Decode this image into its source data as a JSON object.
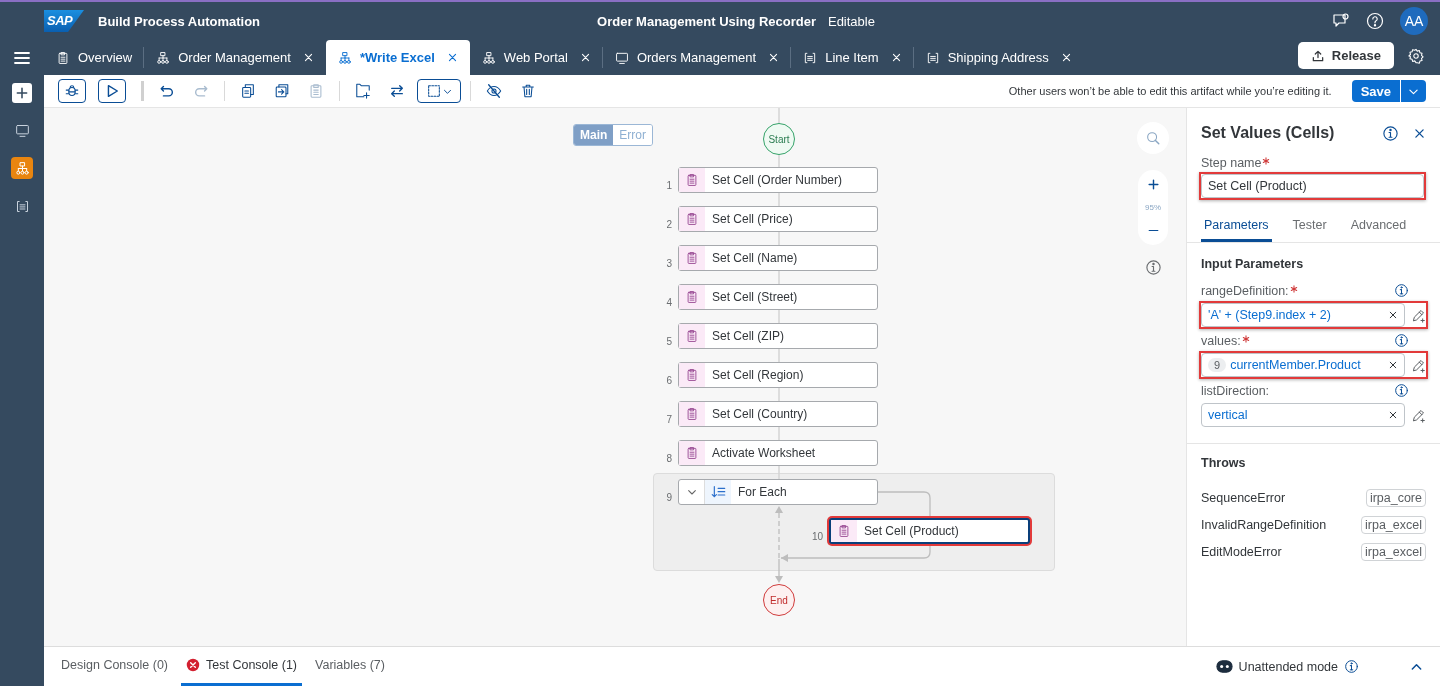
{
  "header": {
    "logo": "SAP",
    "product": "Build Process Automation",
    "title": "Order Management Using Recorder",
    "status": "Editable",
    "avatar": "AA"
  },
  "tabs": [
    {
      "label": "Overview",
      "kind": "overview",
      "closable": false,
      "selected": false
    },
    {
      "label": "Order Management",
      "kind": "process",
      "closable": true,
      "selected": false
    },
    {
      "label": "*Write Excel",
      "kind": "process",
      "closable": true,
      "selected": true
    },
    {
      "label": "Web Portal",
      "kind": "process",
      "closable": true,
      "selected": false
    },
    {
      "label": "Orders Management",
      "kind": "application",
      "closable": true,
      "selected": false
    },
    {
      "label": "Line Item",
      "kind": "data",
      "closable": true,
      "selected": false
    },
    {
      "label": "Shipping Address",
      "kind": "data",
      "closable": true,
      "selected": false
    }
  ],
  "release_button": "Release",
  "sidebar": {
    "items": [
      {
        "kind": "application",
        "selected": false
      },
      {
        "kind": "process",
        "selected": true
      },
      {
        "kind": "data",
        "selected": false
      }
    ]
  },
  "toolbar": {
    "buttons": [
      {
        "kind": "debug",
        "disabled": false
      },
      {
        "kind": "run",
        "disabled": false
      },
      {
        "kind": "undo",
        "disabled": false
      },
      {
        "kind": "redo",
        "disabled": true
      },
      {
        "kind": "copy",
        "disabled": false
      },
      {
        "kind": "duplicate",
        "disabled": false
      },
      {
        "kind": "paste",
        "disabled": true
      },
      {
        "kind": "add-group",
        "disabled": false
      },
      {
        "kind": "swap",
        "disabled": false
      },
      {
        "kind": "select",
        "disabled": false
      },
      {
        "kind": "hide",
        "disabled": false
      },
      {
        "kind": "delete",
        "disabled": false
      }
    ],
    "notice": "Other users won’t be able to edit this artifact while you’re editing it.",
    "save": "Save"
  },
  "canvas": {
    "mode_toggle": [
      {
        "label": "Main",
        "selected": true
      },
      {
        "label": "Error",
        "selected": false
      }
    ],
    "start": "Start",
    "end": "End",
    "zoom": "95%",
    "steps": [
      {
        "number": "1",
        "label": "Set Cell (Order Number)",
        "kind": "activity",
        "highlighted": false
      },
      {
        "number": "2",
        "label": "Set Cell (Price)",
        "kind": "activity",
        "highlighted": false
      },
      {
        "number": "3",
        "label": "Set Cell (Name)",
        "kind": "activity",
        "highlighted": false
      },
      {
        "number": "4",
        "label": "Set Cell (Street)",
        "kind": "activity",
        "highlighted": false
      },
      {
        "number": "5",
        "label": "Set Cell (ZIP)",
        "kind": "activity",
        "highlighted": false
      },
      {
        "number": "6",
        "label": "Set Cell (Region)",
        "kind": "activity",
        "highlighted": false
      },
      {
        "number": "7",
        "label": "Set Cell (Country)",
        "kind": "activity",
        "highlighted": false
      },
      {
        "number": "8",
        "label": "Activate Worksheet",
        "kind": "activity",
        "highlighted": false
      },
      {
        "number": "9",
        "label": "For Each",
        "kind": "loop",
        "highlighted": false,
        "expanded": true,
        "children": [
          {
            "number": "10",
            "label": "Set Cell (Product)",
            "kind": "activity",
            "highlighted": true
          }
        ]
      }
    ]
  },
  "panel": {
    "title": "Set Values (Cells)",
    "step_name": {
      "label": "Step name",
      "required": true,
      "value": "Set Cell (Product)",
      "highlighted": true
    },
    "tabs": [
      {
        "label": "Parameters",
        "selected": true
      },
      {
        "label": "Tester",
        "selected": false
      },
      {
        "label": "Advanced",
        "selected": false
      }
    ],
    "section": "Input Parameters",
    "params": [
      {
        "label": "rangeDefinition:",
        "required": true,
        "value": "'A' + (Step9.index + 2)",
        "highlighted": true
      },
      {
        "label": "values:",
        "required": true,
        "badge": "9",
        "value": "currentMember.Product",
        "highlighted": true
      },
      {
        "label": "listDirection:",
        "required": false,
        "value": "vertical",
        "highlighted": false
      }
    ],
    "throws_title": "Throws",
    "throws": [
      {
        "name": "SequenceError",
        "tag": "irpa_core"
      },
      {
        "name": "InvalidRangeDefinition",
        "tag": "irpa_excel"
      },
      {
        "name": "EditModeError",
        "tag": "irpa_excel"
      }
    ]
  },
  "bottom": {
    "tabs": [
      {
        "label": "Design Console (0)",
        "error": false,
        "selected": false
      },
      {
        "label": "Test Console (1)",
        "error": true,
        "selected": true
      },
      {
        "label": "Variables (7)",
        "error": false,
        "selected": false
      }
    ],
    "mode": "Unattended mode"
  }
}
